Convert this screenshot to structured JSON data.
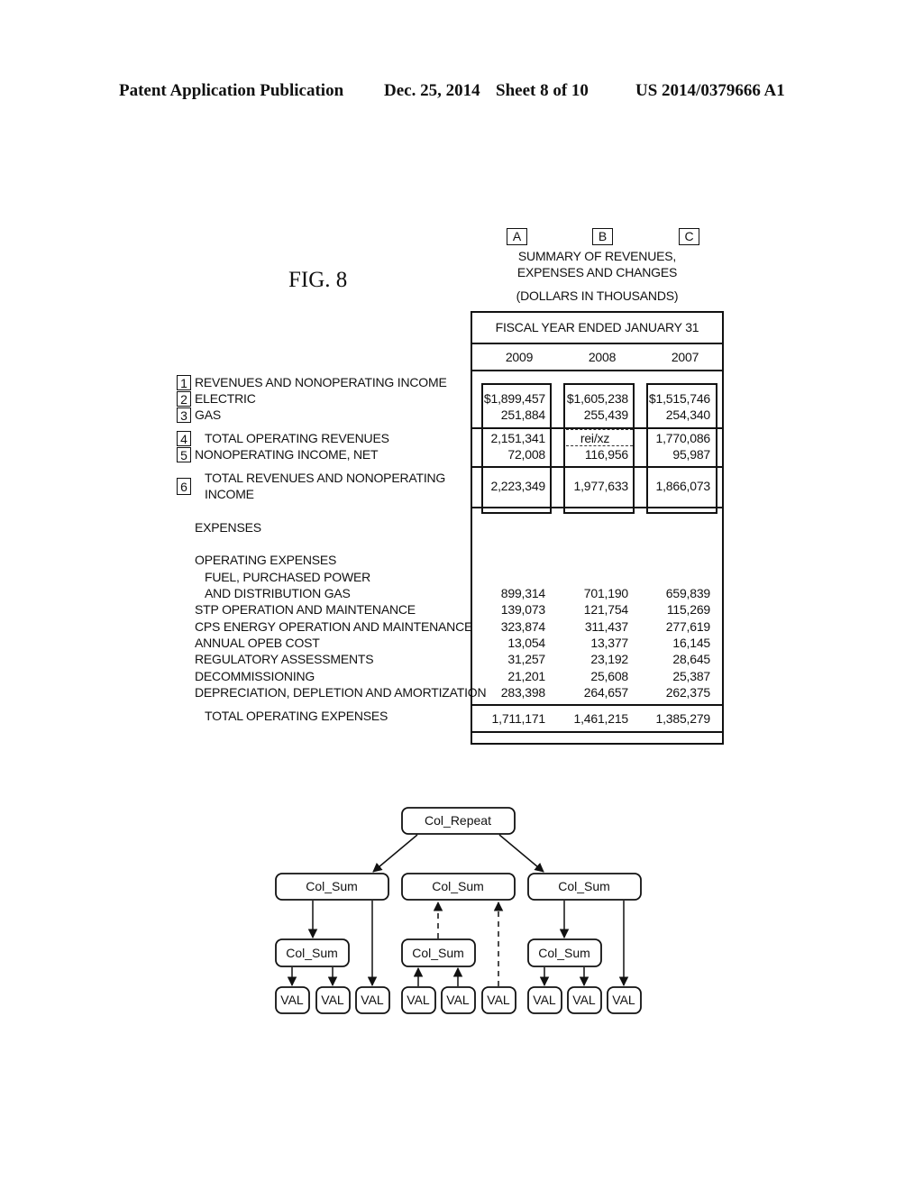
{
  "header": {
    "publication": "Patent Application Publication",
    "date": "Dec. 25, 2014",
    "sheet": "Sheet 8 of 10",
    "patent_number": "US 2014/0379666 A1"
  },
  "figure": {
    "label": "FIG. 8"
  },
  "column_markers": [
    "A",
    "B",
    "C"
  ],
  "title": {
    "line1": "SUMMARY OF REVENUES,",
    "line2": "EXPENSES AND CHANGES",
    "units": "(DOLLARS IN THOUSANDS)"
  },
  "table": {
    "group_header": "FISCAL YEAR ENDED JANUARY 31",
    "years": [
      "2009",
      "2008",
      "2007"
    ],
    "row_markers": [
      "1",
      "2",
      "3",
      "4",
      "5",
      "6"
    ],
    "labels": {
      "revenues_heading": "REVENUES AND NONOPERATING INCOME",
      "electric": "ELECTRIC",
      "gas": "GAS",
      "total_operating_revenues": "TOTAL OPERATING REVENUES",
      "nonoperating_income": "NONOPERATING INCOME, NET",
      "total_revenues_line1": "TOTAL REVENUES AND NONOPERATING",
      "total_revenues_line2": "INCOME",
      "expenses": "EXPENSES",
      "operating_expenses": "OPERATING EXPENSES",
      "fuel_line1": "FUEL, PURCHASED POWER",
      "fuel_line2": "AND DISTRIBUTION GAS",
      "stp": "STP OPERATION AND MAINTENANCE",
      "cps": "CPS ENERGY OPERATION AND MAINTENANCE",
      "opeb": "ANNUAL OPEB COST",
      "regulatory": "REGULATORY ASSESSMENTS",
      "decommissioning": "DECOMMISSIONING",
      "depreciation": "DEPRECIATION, DEPLETION AND AMORTIZATION",
      "total_operating_expenses": "TOTAL OPERATING EXPENSES"
    },
    "values": {
      "electric": [
        "$1,899,457",
        "$1,605,238",
        "$1,515,746"
      ],
      "gas": [
        "251,884",
        "255,439",
        "254,340"
      ],
      "total_operating_revenues": [
        "2,151,341",
        "rei/xz",
        "1,770,086"
      ],
      "nonoperating_income": [
        "72,008",
        "116,956",
        "95,987"
      ],
      "total_revenues": [
        "2,223,349",
        "1,977,633",
        "1,866,073"
      ],
      "fuel": [
        "899,314",
        "701,190",
        "659,839"
      ],
      "stp": [
        "139,073",
        "121,754",
        "115,269"
      ],
      "cps": [
        "323,874",
        "311,437",
        "277,619"
      ],
      "opeb": [
        "13,054",
        "13,377",
        "16,145"
      ],
      "regulatory": [
        "31,257",
        "23,192",
        "28,645"
      ],
      "decommissioning": [
        "21,201",
        "25,608",
        "25,387"
      ],
      "depreciation": [
        "283,398",
        "264,657",
        "262,375"
      ],
      "total_operating_expenses": [
        "1,711,171",
        "1,461,215",
        "1,385,279"
      ]
    }
  },
  "tree": {
    "root": "Col_Repeat",
    "level1": [
      "Col_Sum",
      "Col_Sum",
      "Col_Sum"
    ],
    "level2": [
      "Col_Sum",
      "Col_Sum",
      "Col_Sum"
    ],
    "leaf": "VAL"
  }
}
